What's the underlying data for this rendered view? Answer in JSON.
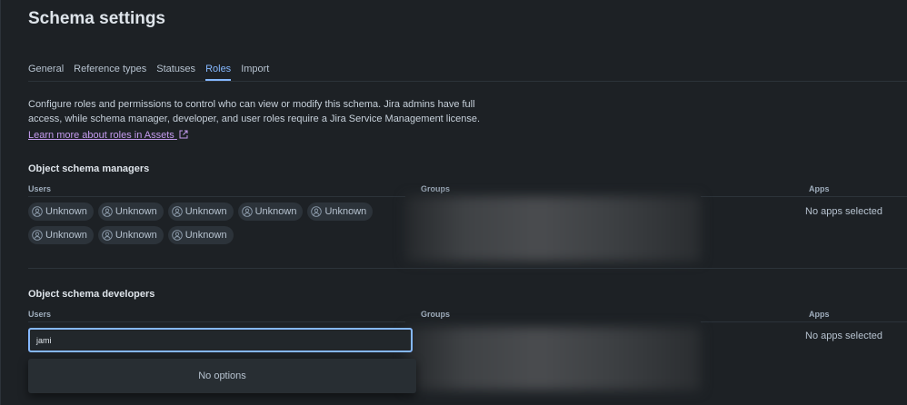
{
  "page": {
    "title": "Schema settings"
  },
  "tabs": [
    {
      "label": "General"
    },
    {
      "label": "Reference types"
    },
    {
      "label": "Statuses"
    },
    {
      "label": "Roles"
    },
    {
      "label": "Import"
    }
  ],
  "active_tab": "Roles",
  "description": "Configure roles and permissions to control who can view or modify this schema. Jira admins have full access, while schema manager, developer, and user roles require a Jira Service Management license.",
  "learn_more": "Learn more about roles in Assets",
  "columns": {
    "users": "Users",
    "groups": "Groups",
    "apps": "Apps"
  },
  "managers": {
    "title": "Object schema managers",
    "users": [
      "Unknown",
      "Unknown",
      "Unknown",
      "Unknown",
      "Unknown",
      "Unknown",
      "Unknown",
      "Unknown"
    ],
    "apps": "No apps selected"
  },
  "developers": {
    "title": "Object schema developers",
    "input_value": "jami",
    "dropdown_text": "No options",
    "apps": "No apps selected"
  },
  "colors": {
    "accent": "#85b8ff",
    "link": "#c59cf0",
    "background": "#1d2125"
  }
}
